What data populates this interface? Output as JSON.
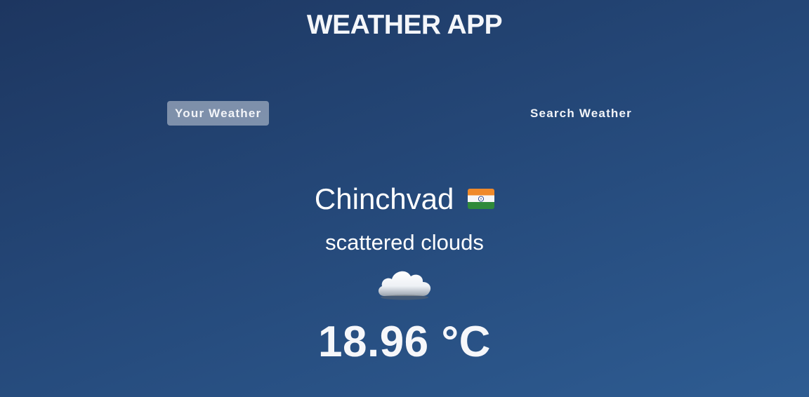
{
  "app": {
    "title": "WEATHER APP"
  },
  "tabs": [
    {
      "label": "Your Weather",
      "active": true
    },
    {
      "label": "Search Weather",
      "active": false
    }
  ],
  "weather": {
    "city": "Chinchvad",
    "country_flag_icon": "india-flag-icon",
    "description": "scattered clouds",
    "condition_icon": "cloud-icon",
    "temperature": "18.96 °C"
  },
  "colors": {
    "background_top": "#1d3660",
    "background_bottom": "#2e5c92",
    "active_tab_bg": "rgba(255,255,255,0.42)",
    "text": "#ffffff"
  }
}
